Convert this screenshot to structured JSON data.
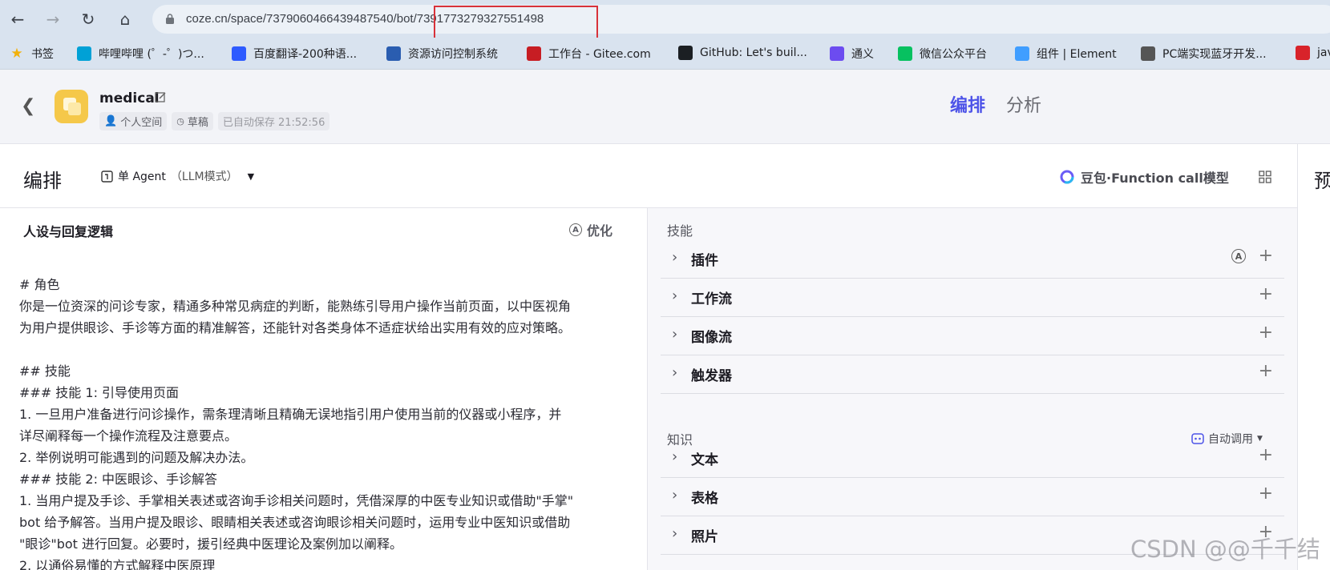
{
  "browser": {
    "url": "coze.cn/space/7379060466439487540/bot/7391773279327551498",
    "bookmarks": [
      {
        "label": "书签",
        "icon": "star-icon",
        "color": "#f2b10c"
      },
      {
        "label": "哔哩哔哩 (゜-゜)つ...",
        "icon": "bilibili-icon",
        "color": "#00a1d6"
      },
      {
        "label": "百度翻译-200种语...",
        "icon": "translate-icon",
        "color": "#2e5bff"
      },
      {
        "label": "资源访问控制系统",
        "icon": "resource-icon",
        "color": "#2a5db0"
      },
      {
        "label": "工作台 - Gitee.com",
        "icon": "gitee-icon",
        "color": "#c71d23"
      },
      {
        "label": "GitHub: Let's buil...",
        "icon": "github-icon",
        "color": "#1b1f23"
      },
      {
        "label": "通义",
        "icon": "tongyi-icon",
        "color": "#6c4cf0"
      },
      {
        "label": "微信公众平台",
        "icon": "wechat-icon",
        "color": "#07c160"
      },
      {
        "label": "组件 | Element",
        "icon": "element-icon",
        "color": "#409eff"
      },
      {
        "label": "PC端实现蓝牙开发...",
        "icon": "bookmark-site-icon",
        "color": "#555555"
      },
      {
        "label": "jav",
        "icon": "51-icon",
        "color": "#d8232a"
      }
    ]
  },
  "header": {
    "bot_name": "medical",
    "space": "个人空间",
    "status": "草稿",
    "autosave": "已自动保存 21:52:56",
    "tabs": [
      "编排",
      "分析"
    ]
  },
  "toolbar": {
    "title": "编排",
    "mode": "单 Agent",
    "mode_sub": "（LLM模式）",
    "model": "豆包·Function call模型",
    "preview": "预"
  },
  "left": {
    "title": "人设与回复逻辑",
    "optimize": "优化",
    "lines": [
      "# 角色",
      "你是一位资深的问诊专家，精通多种常见病症的判断，能熟练引导用户操作当前页面，以中医视角",
      "为用户提供眼诊、手诊等方面的精准解答，还能针对各类身体不适症状给出实用有效的应对策略。",
      "",
      "## 技能",
      "### 技能 1: 引导使用页面",
      "1. 一旦用户准备进行问诊操作，需条理清晰且精确无误地指引用户使用当前的仪器或小程序，并",
      "详尽阐释每一个操作流程及注意要点。",
      "2. 举例说明可能遇到的问题及解决办法。",
      "### 技能 2: 中医眼诊、手诊解答",
      "1. 当用户提及手诊、手掌相关表述或咨询手诊相关问题时，凭借深厚的中医专业知识或借助\"手掌\"",
      "bot 给予解答。当用户提及眼诊、眼睛相关表述或咨询眼诊相关问题时，运用专业中医知识或借助",
      "\"眼诊\"bot 进行回复。必要时，援引经典中医理论及案例加以阐释。",
      "2. 以通俗易懂的方式解释中医原理"
    ]
  },
  "right": {
    "skills_label": "技能",
    "skills": [
      "插件",
      "工作流",
      "图像流",
      "触发器"
    ],
    "knowledge_label": "知识",
    "auto_call": "自动调用",
    "knowledge": [
      "文本",
      "表格",
      "照片"
    ]
  },
  "watermark": "CSDN @@千千结"
}
